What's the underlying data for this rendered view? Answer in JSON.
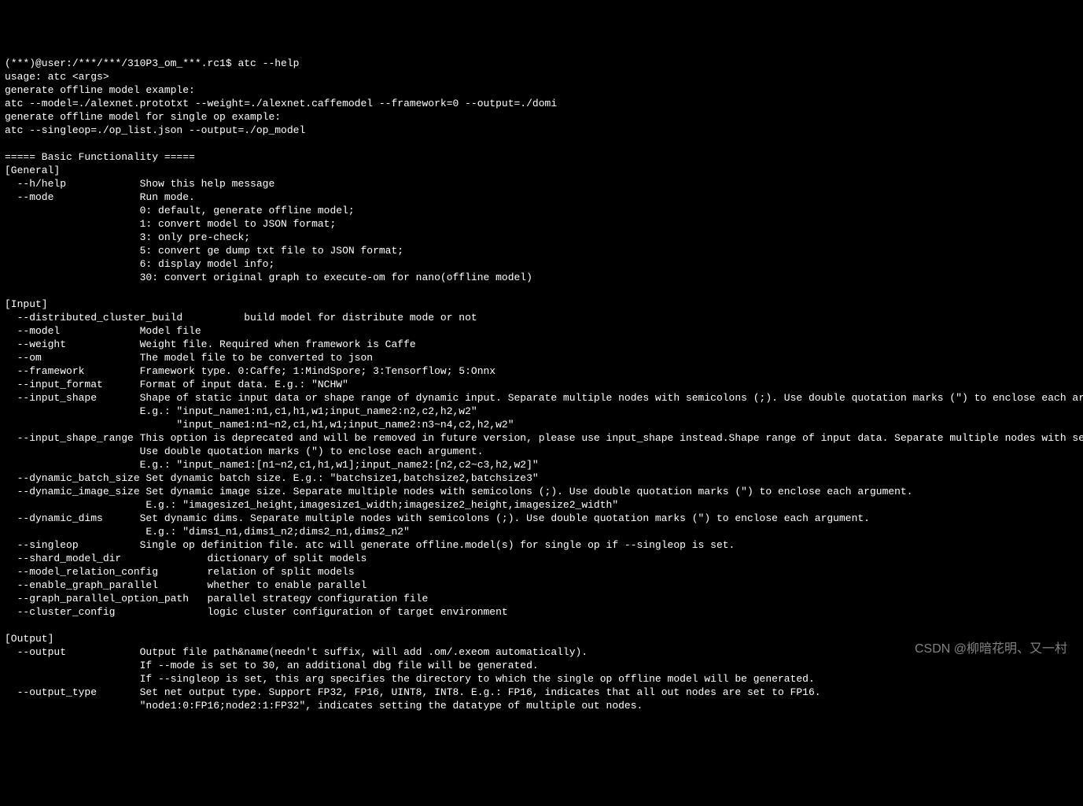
{
  "prompt": "(***)@user:/***/***/310P3_om_***.rc1$ atc --help",
  "usage": "usage: atc <args>",
  "desc1": "generate offline model example:",
  "ex1": "atc --model=./alexnet.prototxt --weight=./alexnet.caffemodel --framework=0 --output=./domi",
  "desc2": "generate offline model for single op example:",
  "ex2": "atc --singleop=./op_list.json --output=./op_model",
  "sec_basic": "===== Basic Functionality =====",
  "general_hdr": "[General]",
  "help_flag": "  --h/help            Show this help message",
  "mode_flag": "  --mode              Run mode.",
  "mode0": "                      0: default, generate offline model;",
  "mode1": "                      1: convert model to JSON format;",
  "mode3": "                      3: only pre-check;",
  "mode5": "                      5: convert ge dump txt file to JSON format;",
  "mode6": "                      6: display model info;",
  "mode30": "                      30: convert original graph to execute-om for nano(offline model)",
  "input_hdr": "[Input]",
  "dist": "  --distributed_cluster_build          build model for distribute mode or not",
  "model": "  --model             Model file",
  "weight": "  --weight            Weight file. Required when framework is Caffe",
  "om": "  --om                The model file to be converted to json",
  "framework": "  --framework         Framework type. 0:Caffe; 1:MindSpore; 3:Tensorflow; 5:Onnx",
  "input_format": "  --input_format      Format of input data. E.g.: \"NCHW\"",
  "input_shape": "  --input_shape       Shape of static input data or shape range of dynamic input. Separate multiple nodes with semicolons (;). Use double quotation marks (\") to enclose each argument.",
  "input_shape_eg1": "                      E.g.: \"input_name1:n1,c1,h1,w1;input_name2:n2,c2,h2,w2\"",
  "input_shape_eg2": "                            \"input_name1:n1~n2,c1,h1,w1;input_name2:n3~n4,c2,h2,w2\"",
  "input_shape_range": "  --input_shape_range This option is deprecated and will be removed in future version, please use input_shape instead.Shape range of input data. Separate multiple nodes with semicolons (;).",
  "input_shape_range2": "                      Use double quotation marks (\") to enclose each argument.",
  "input_shape_range_eg": "                      E.g.: \"input_name1:[n1~n2,c1,h1,w1];input_name2:[n2,c2~c3,h2,w2]\"",
  "dyn_batch": "  --dynamic_batch_size Set dynamic batch size. E.g.: \"batchsize1,batchsize2,batchsize3\"",
  "dyn_image": "  --dynamic_image_size Set dynamic image size. Separate multiple nodes with semicolons (;). Use double quotation marks (\") to enclose each argument.",
  "dyn_image_eg": "                       E.g.: \"imagesize1_height,imagesize1_width;imagesize2_height,imagesize2_width\"",
  "dyn_dims": "  --dynamic_dims      Set dynamic dims. Separate multiple nodes with semicolons (;). Use double quotation marks (\") to enclose each argument.",
  "dyn_dims_eg": "                       E.g.: \"dims1_n1,dims1_n2;dims2_n1,dims2_n2\"",
  "singleop": "  --singleop          Single op definition file. atc will generate offline.model(s) for single op if --singleop is set.",
  "shard": "  --shard_model_dir              dictionary of split models",
  "model_relation": "  --model_relation_config        relation of split models",
  "enable_gp": "  --enable_graph_parallel        whether to enable parallel",
  "gp_option": "  --graph_parallel_option_path   parallel strategy configuration file",
  "cluster": "  --cluster_config               logic cluster configuration of target environment",
  "output_hdr": "[Output]",
  "output": "  --output            Output file path&name(needn't suffix, will add .om/.exeom automatically).",
  "output2": "                      If --mode is set to 30, an additional dbg file will be generated.",
  "output3": "                      If --singleop is set, this arg specifies the directory to which the single op offline model will be generated.",
  "output_type": "  --output_type       Set net output type. Support FP32, FP16, UINT8, INT8. E.g.: FP16, indicates that all out nodes are set to FP16.",
  "output_type2": "                      \"node1:0:FP16;node2:1:FP32\", indicates setting the datatype of multiple out nodes.",
  "watermark": "CSDN @柳暗花明、又一村"
}
